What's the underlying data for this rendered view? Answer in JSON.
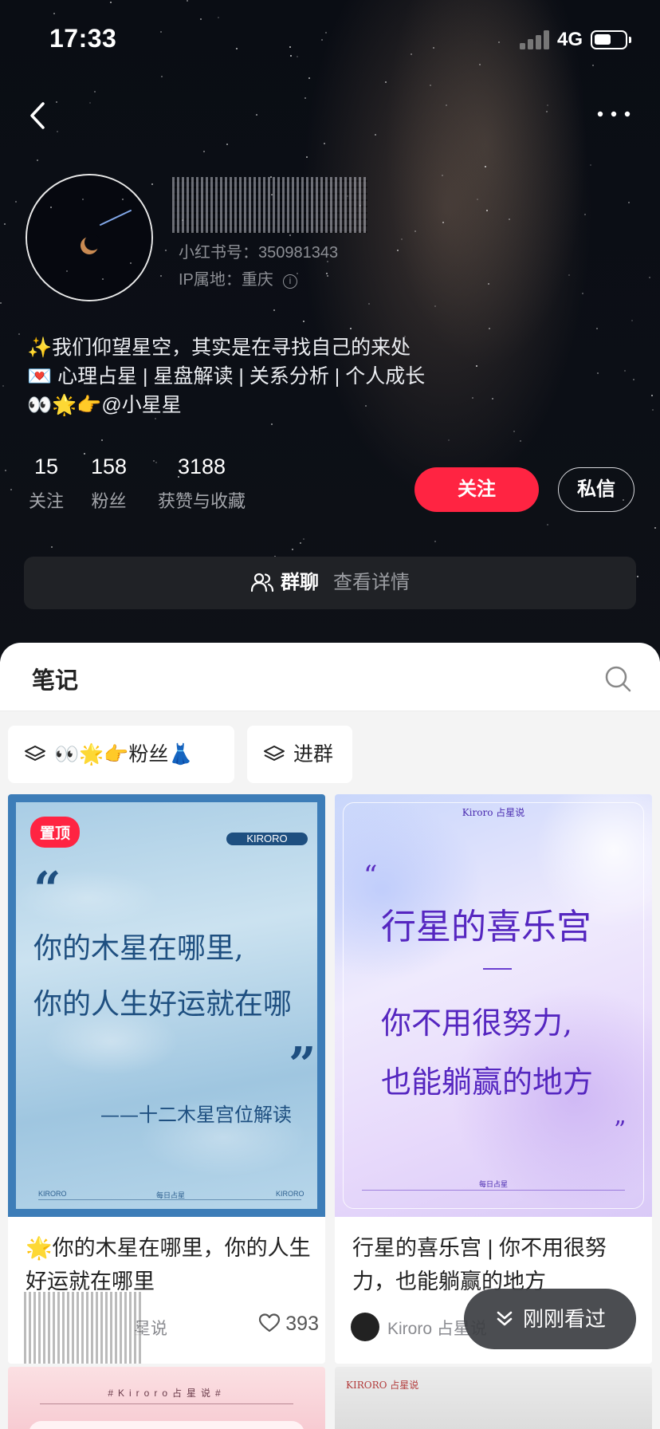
{
  "status_bar": {
    "time": "17:33",
    "network": "4G"
  },
  "profile": {
    "redbook_id": "小红书号：350981343",
    "ip_location": "IP属地：重庆",
    "bio": [
      "✨我们仰望星空，其实是在寻找自己的来处",
      "💌 心理占星 | 星盘解读 | 关系分析 | 个人成长",
      "👀🌟👉@小星星"
    ],
    "stats": [
      {
        "num": "15",
        "label": "关注"
      },
      {
        "num": "158",
        "label": "粉丝"
      },
      {
        "num": "3188",
        "label": "获赞与收藏"
      }
    ],
    "follow_label": "关注",
    "message_label": "私信"
  },
  "group_chat": {
    "title": "群聊",
    "subtitle": "查看详情"
  },
  "notes_tab": {
    "title": "笔记"
  },
  "chips": [
    "👀🌟👉粉丝👗",
    "进群"
  ],
  "cards": [
    {
      "pin_label": "置顶",
      "cover_brand": "KIRORO",
      "cover_lines": [
        "你的木星在哪里,",
        "你的人生好运就在哪"
      ],
      "cover_sub": "——十二木星宫位解读",
      "cover_footer": [
        "KIRORO",
        "每日占星",
        "KIRORO"
      ],
      "title": "🌟你的木星在哪里，你的人生好运就在哪里",
      "author": "星说",
      "likes": "393"
    },
    {
      "cover_brand": "Kiroro 占星说",
      "cover_title": "行星的喜乐宫",
      "cover_lines": [
        "你不用很努力,",
        "也能躺赢的地方"
      ],
      "cover_footer": "每日占星",
      "title": "行星的喜乐宫 | 你不用很努力，也能躺赢的地方",
      "author": "Kiroro 占星说"
    }
  ],
  "peek_cards": [
    {
      "brand": "#Kiroro占星说#"
    },
    {
      "brand": "KIRORO 占星说"
    }
  ],
  "recently_viewed": "刚刚看过",
  "colors": {
    "accent": "#ff2442",
    "hero_bg": "#0c0f16",
    "card1_text": "#1e4f80",
    "card2_text": "#5526c0"
  }
}
